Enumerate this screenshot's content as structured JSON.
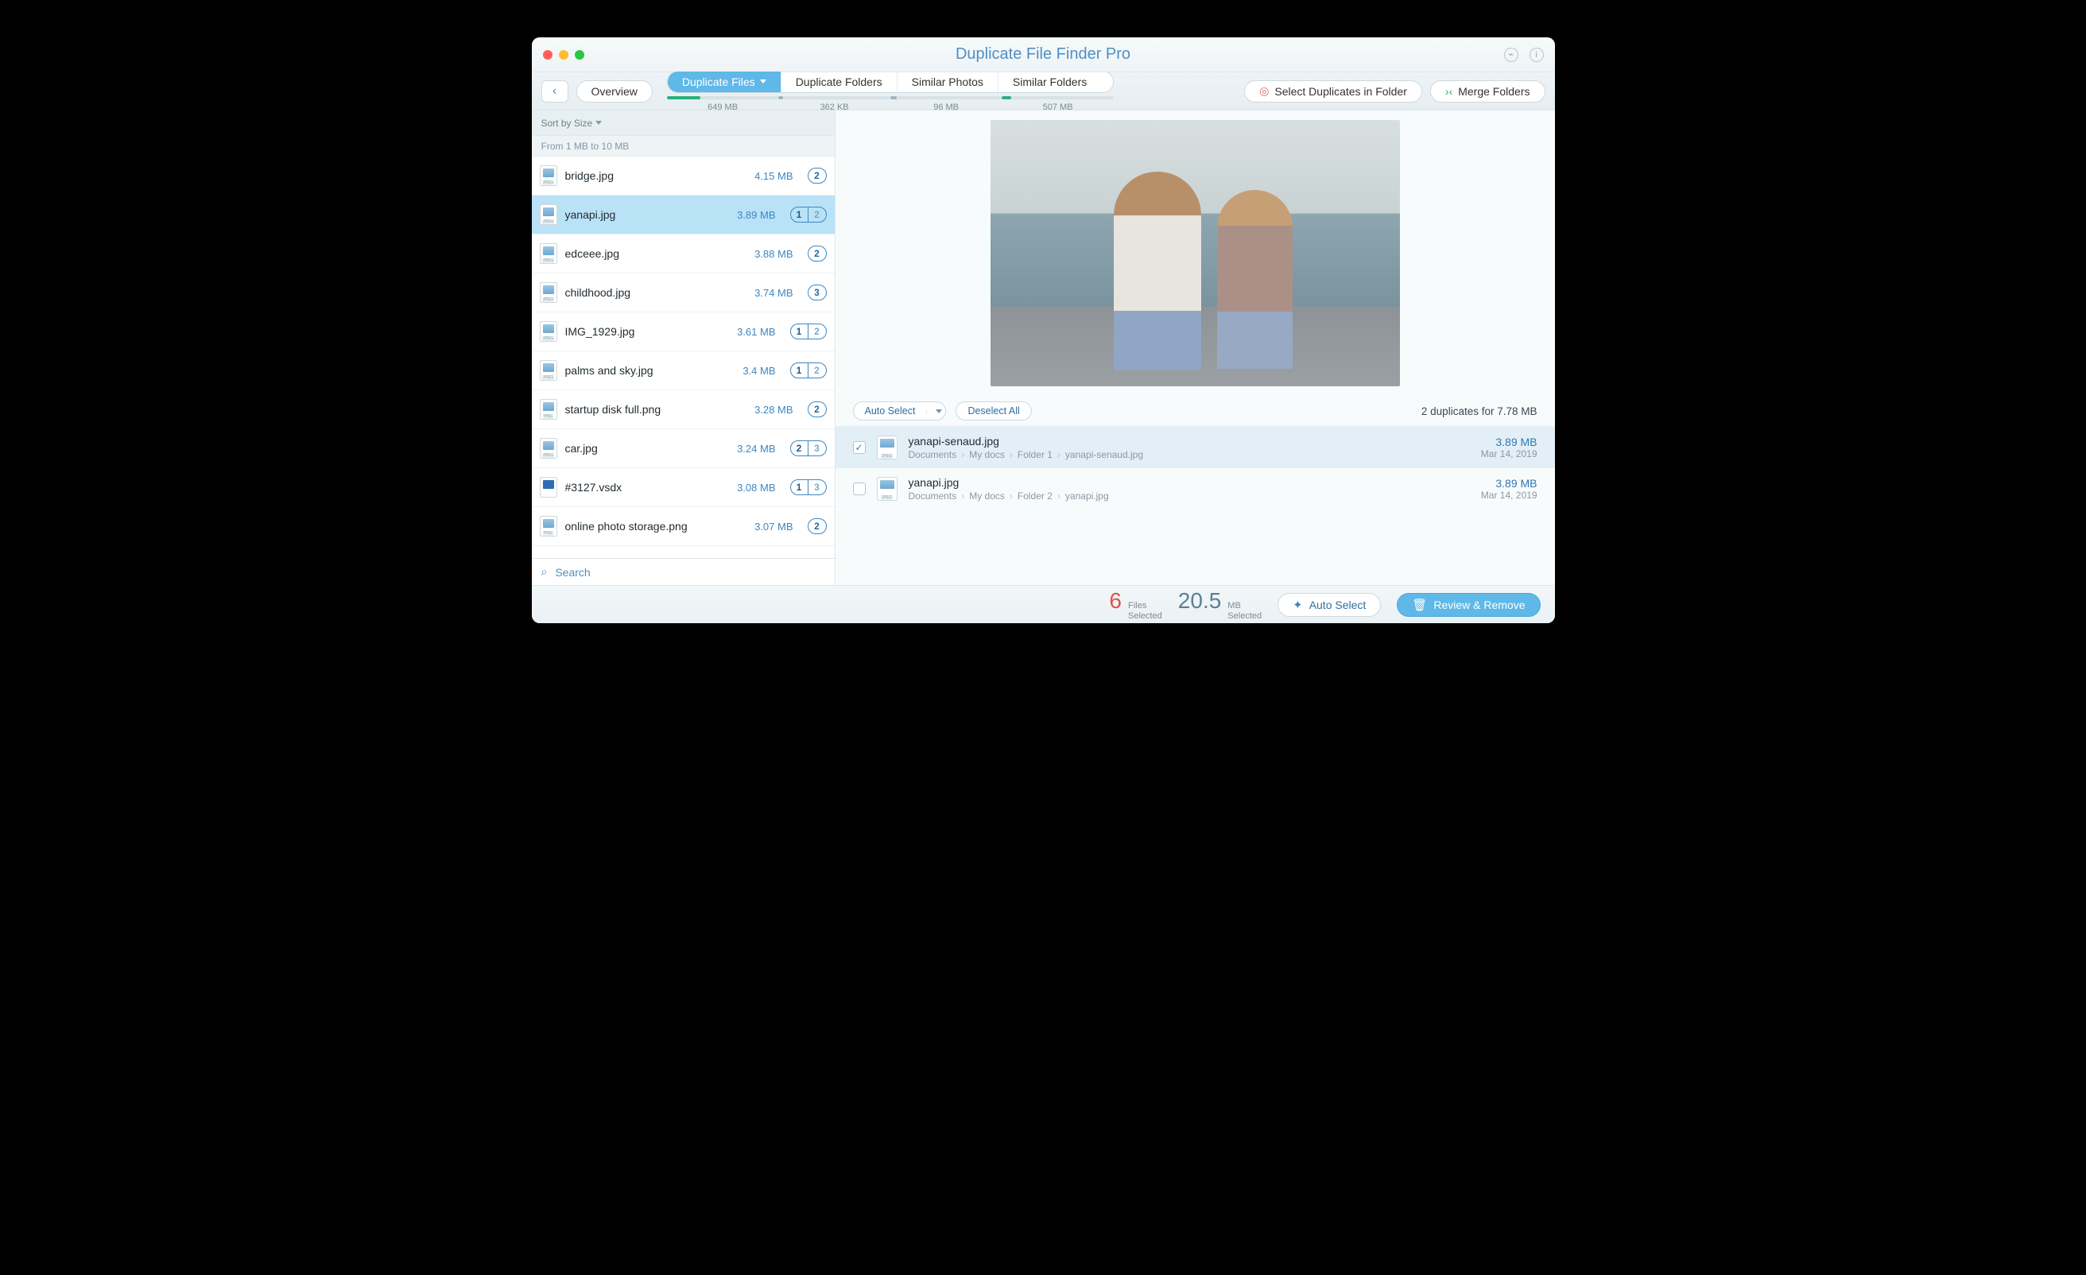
{
  "title": "Duplicate File Finder Pro",
  "toolbar": {
    "back": "‹",
    "overview": "Overview",
    "tabs": [
      {
        "label": "Duplicate Files",
        "size": "649 MB",
        "fill": 30,
        "color": "#2bb07a",
        "active": true
      },
      {
        "label": "Duplicate Folders",
        "size": "362 KB",
        "fill": 4,
        "color": "#9db4c0",
        "active": false
      },
      {
        "label": "Similar Photos",
        "size": "96 MB",
        "fill": 6,
        "color": "#9db4c0",
        "active": false
      },
      {
        "label": "Similar Folders",
        "size": "507 MB",
        "fill": 8,
        "color": "#2bb07a",
        "active": false
      }
    ],
    "select_in_folder": "Select Duplicates in Folder",
    "merge_folders": "Merge Folders"
  },
  "sidebar": {
    "sort_label": "Sort by Size",
    "group_label": "From 1 MB to 10 MB",
    "search_label": "Search",
    "items": [
      {
        "name": "bridge.jpg",
        "size": "4.15 MB",
        "type": "jpeg",
        "count": "2"
      },
      {
        "name": "yanapi.jpg",
        "size": "3.89 MB",
        "type": "jpeg",
        "split": [
          "1",
          "2"
        ],
        "selected": true
      },
      {
        "name": "edceee.jpg",
        "size": "3.88 MB",
        "type": "jpeg",
        "count": "2"
      },
      {
        "name": "childhood.jpg",
        "size": "3.74 MB",
        "type": "jpeg",
        "count": "3"
      },
      {
        "name": "IMG_1929.jpg",
        "size": "3.61 MB",
        "type": "jpeg",
        "split": [
          "1",
          "2"
        ]
      },
      {
        "name": "palms and sky.jpg",
        "size": "3.4 MB",
        "type": "jpeg",
        "split": [
          "1",
          "2"
        ]
      },
      {
        "name": "startup disk full.png",
        "size": "3.28 MB",
        "type": "png",
        "count": "2"
      },
      {
        "name": "car.jpg",
        "size": "3.24 MB",
        "type": "jpeg",
        "split": [
          "2",
          "3"
        ]
      },
      {
        "name": "#3127.vsdx",
        "size": "3.08 MB",
        "type": "vsdx",
        "split": [
          "1",
          "3"
        ]
      },
      {
        "name": "online photo storage.png",
        "size": "3.07 MB",
        "type": "png",
        "count": "2"
      }
    ]
  },
  "details": {
    "auto_select": "Auto Select",
    "deselect_all": "Deselect All",
    "summary": "2 duplicates for 7.78 MB",
    "rows": [
      {
        "checked": true,
        "name": "yanapi-senaud.jpg",
        "path": [
          "Documents",
          "My docs",
          "Folder 1",
          "yanapi-senaud.jpg"
        ],
        "size": "3.89 MB",
        "date": "Mar 14, 2019",
        "sel": true
      },
      {
        "checked": false,
        "name": "yanapi.jpg",
        "path": [
          "Documents",
          "My docs",
          "Folder 2",
          "yanapi.jpg"
        ],
        "size": "3.89 MB",
        "date": "Mar 14, 2019",
        "sel": false
      }
    ]
  },
  "footer": {
    "files_count": "6",
    "files_label1": "Files",
    "files_label2": "Selected",
    "mb_count": "20.5",
    "mb_label1": "MB",
    "mb_label2": "Selected",
    "auto_select": "Auto Select",
    "review_remove": "Review & Remove"
  }
}
